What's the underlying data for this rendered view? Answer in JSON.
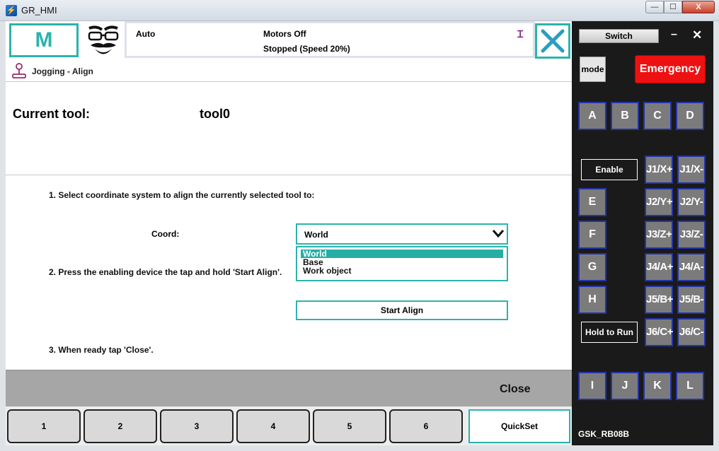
{
  "window": {
    "title": "GR_HMI",
    "min_glyph": "—",
    "max_glyph": "☐",
    "close_glyph": "X"
  },
  "header": {
    "menu_label": "M",
    "status_mode": "Auto",
    "status_motors": "Motors Off",
    "status_state": "Stopped (Speed 20%)",
    "status_icon": "Ɪ"
  },
  "breadcrumb": {
    "label": "Jogging - Align"
  },
  "tool": {
    "label": "Current tool:",
    "value": "tool0"
  },
  "steps": {
    "step1": "1. Select coordinate system to align the currently selected tool to:",
    "step2": "2. Press the enabling device the tap and hold 'Start Align'.",
    "step3": "3. When ready tap 'Close'."
  },
  "coord": {
    "label": "Coord:",
    "selected": "World",
    "options": [
      "World",
      "Base",
      "Work object"
    ]
  },
  "start_align_label": "Start Align",
  "close_label": "Close",
  "tabs": [
    "1",
    "2",
    "3",
    "4",
    "5",
    "6"
  ],
  "quickset_label": "QuickSet",
  "panel": {
    "switch_label": "Switch",
    "min_glyph": "–",
    "close_glyph": "✕",
    "mode_label": "mode",
    "emergency_label": "Emergency",
    "top_keys": [
      "A",
      "B",
      "C",
      "D"
    ],
    "side_keys": [
      "E",
      "F",
      "G",
      "H"
    ],
    "bottom_keys": [
      "I",
      "J",
      "K",
      "L"
    ],
    "enable_label": "Enable",
    "hold_label": "Hold to Run",
    "jog_plus": [
      "J1/X+",
      "J2/Y+",
      "J3/Z+",
      "J4/A+",
      "J5/B+",
      "J6/C+"
    ],
    "jog_minus": [
      "J1/X-",
      "J2/Y-",
      "J3/Z-",
      "J4/A-",
      "J5/B-",
      "J6/C-"
    ],
    "model": "GSK_RB08B"
  },
  "colors": {
    "accent": "#2cb3ad",
    "emergency": "#ee1111",
    "panel_bg": "#1a1a1a",
    "key_border": "#2233aa"
  }
}
